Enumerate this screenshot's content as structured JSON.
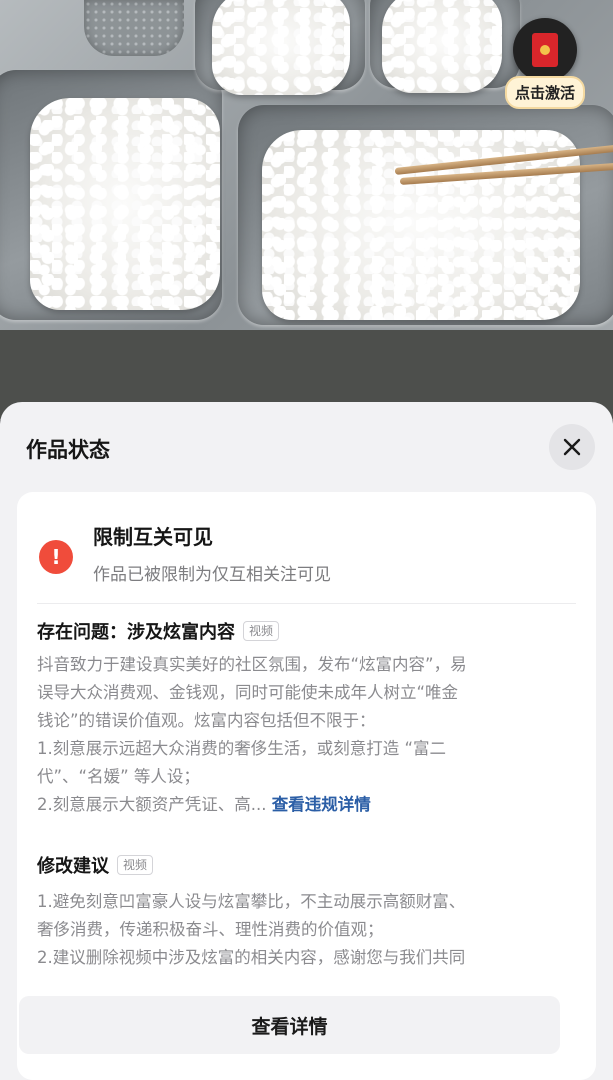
{
  "widget": {
    "activate_label": "点击激活",
    "icon": "red-envelope-icon"
  },
  "sheet": {
    "title": "作品状态",
    "close_icon": "close-icon",
    "status": {
      "icon": "exclamation-icon",
      "title": "限制互关可见",
      "subtitle": "作品已被限制为仅互相关注可见"
    },
    "issue": {
      "heading": "存在问题：涉及炫富内容",
      "tag": "视频",
      "lines": [
        "抖音致力于建设真实美好的社区氛围，发布“炫富内容”，易",
        "误导大众消费观、金钱观，同时可能使未成年人树立“唯金",
        "钱论”的错误价值观。炫富内容包括但不限于：",
        "1.刻意展示远超大众消费的奢侈生活，或刻意打造 “富二",
        "代”、“名媛” 等人设；"
      ],
      "last_line": "2.刻意展示大额资产凭证、高...",
      "link": "查看违规详情"
    },
    "suggestion": {
      "heading": "修改建议",
      "tag": "视频",
      "lines": [
        "1.避免刻意凹富豪人设与炫富攀比，不主动展示高额财富、",
        "奢侈消费，传递积极奋斗、理性消费的价值观；",
        "2.建议删除视频中涉及炫富的相关内容，感谢您与我们共同"
      ]
    },
    "detail_button": "查看详情"
  },
  "colors": {
    "warn": "#f04c3b",
    "link": "#2b5ea6",
    "sheet_bg": "#f2f2f4"
  }
}
